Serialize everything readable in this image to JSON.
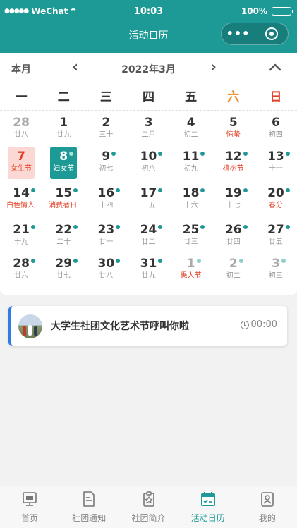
{
  "status_bar": {
    "carrier": "WeChat",
    "time": "10:03",
    "battery": "100%"
  },
  "nav": {
    "title": "活动日历",
    "more_label": "•••"
  },
  "calendar": {
    "today_label": "本月",
    "month_title": "2022年3月",
    "weekdays": [
      "一",
      "二",
      "三",
      "四",
      "五",
      "六",
      "日"
    ],
    "weeks": [
      [
        {
          "day": "28",
          "sub": "廿八",
          "other": true
        },
        {
          "day": "1",
          "sub": "廿九"
        },
        {
          "day": "2",
          "sub": "三十"
        },
        {
          "day": "3",
          "sub": "二月"
        },
        {
          "day": "4",
          "sub": "初二"
        },
        {
          "day": "5",
          "sub": "惊蛰",
          "red": true
        },
        {
          "day": "6",
          "sub": "初四"
        }
      ],
      [
        {
          "day": "7",
          "sub": "女生节",
          "today": true
        },
        {
          "day": "8",
          "sub": "妇女节",
          "selected": true,
          "dot": true
        },
        {
          "day": "9",
          "sub": "初七",
          "dot": true
        },
        {
          "day": "10",
          "sub": "初八",
          "dot": true
        },
        {
          "day": "11",
          "sub": "初九",
          "dot": true
        },
        {
          "day": "12",
          "sub": "植树节",
          "red": true,
          "dot": true
        },
        {
          "day": "13",
          "sub": "十一",
          "dot": true
        }
      ],
      [
        {
          "day": "14",
          "sub": "白色情人",
          "red": true,
          "dot": true,
          "wrap": true
        },
        {
          "day": "15",
          "sub": "消费者日",
          "red": true,
          "dot": true,
          "wrap": true
        },
        {
          "day": "16",
          "sub": "十四",
          "dot": true
        },
        {
          "day": "17",
          "sub": "十五",
          "dot": true
        },
        {
          "day": "18",
          "sub": "十六",
          "dot": true
        },
        {
          "day": "19",
          "sub": "十七",
          "dot": true
        },
        {
          "day": "20",
          "sub": "春分",
          "red": true,
          "dot": true
        }
      ],
      [
        {
          "day": "21",
          "sub": "十九",
          "dot": true
        },
        {
          "day": "22",
          "sub": "二十",
          "dot": true
        },
        {
          "day": "23",
          "sub": "廿一",
          "dot": true
        },
        {
          "day": "24",
          "sub": "廿二",
          "dot": true
        },
        {
          "day": "25",
          "sub": "廿三",
          "dot": true
        },
        {
          "day": "26",
          "sub": "廿四",
          "dot": true
        },
        {
          "day": "27",
          "sub": "廿五",
          "dot": true
        }
      ],
      [
        {
          "day": "28",
          "sub": "廿六",
          "dot": true
        },
        {
          "day": "29",
          "sub": "廿七",
          "dot": true
        },
        {
          "day": "30",
          "sub": "廿八",
          "dot": true
        },
        {
          "day": "31",
          "sub": "廿九",
          "dot": true
        },
        {
          "day": "1",
          "sub": "愚人节",
          "other": true,
          "red": true,
          "dot": true
        },
        {
          "day": "2",
          "sub": "初二",
          "other": true,
          "dot": true
        },
        {
          "day": "3",
          "sub": "初三",
          "other": true,
          "dot": true
        }
      ]
    ]
  },
  "activities": [
    {
      "title": "大学生社团文化艺术节呼叫你啦",
      "time": "00:00"
    }
  ],
  "tabbar": [
    {
      "label": "首页",
      "icon": "home-icon"
    },
    {
      "label": "社团通知",
      "icon": "notice-icon"
    },
    {
      "label": "社团简介",
      "icon": "profile-icon"
    },
    {
      "label": "活动日历",
      "icon": "calendar-icon",
      "active": true
    },
    {
      "label": "我的",
      "icon": "user-icon"
    }
  ],
  "colors": {
    "primary": "#1d9a96",
    "accent_red": "#e0432a",
    "saturday": "#e68a1f",
    "card_border": "#2f7de1"
  }
}
